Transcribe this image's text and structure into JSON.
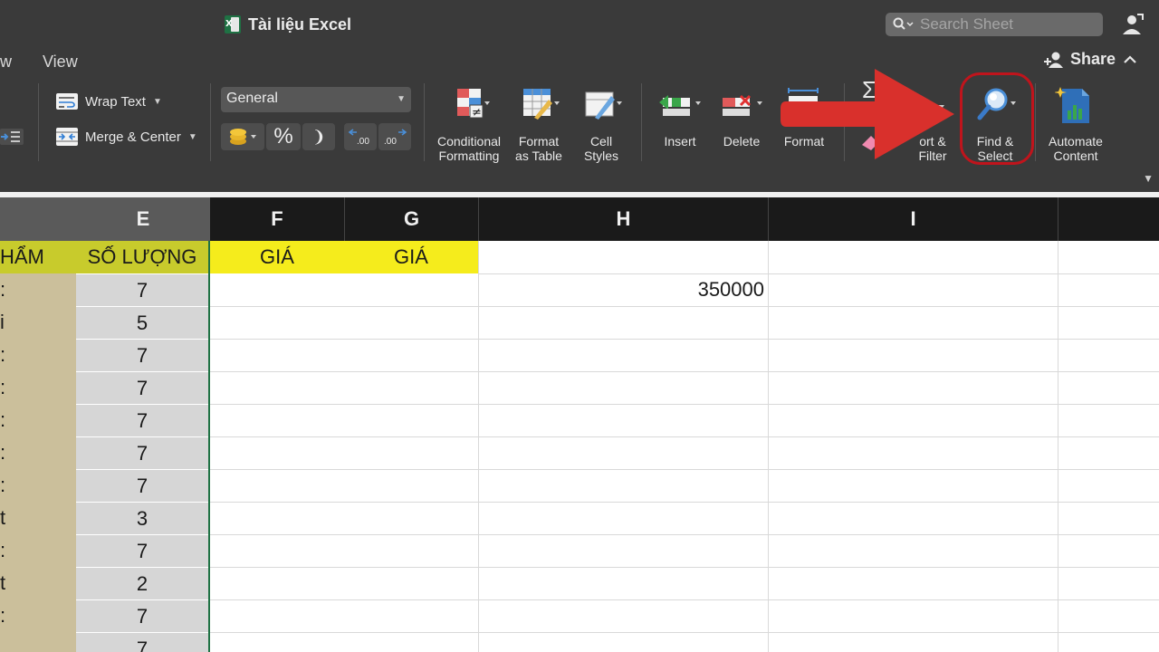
{
  "window": {
    "title": "Tài liệu Excel",
    "search_placeholder": "Search Sheet"
  },
  "menu": {
    "tabs": [
      {
        "label": "w"
      },
      {
        "label": "View"
      }
    ],
    "share_label": "Share",
    "collapse_icon": "chevron-up-icon"
  },
  "ribbon": {
    "wrap_text": "Wrap Text",
    "merge_center": "Merge & Center",
    "number_format": "General",
    "percent": "%",
    "comma": "❩",
    "inc_decimal": ".00",
    "dec_decimal": ".00",
    "conditional_formatting": {
      "line1": "Conditional",
      "line2": "Formatting"
    },
    "format_as_table": {
      "line1": "Format",
      "line2": "as Table"
    },
    "cell_styles": {
      "line1": "Cell",
      "line2": "Styles"
    },
    "insert": "Insert",
    "delete": "Delete",
    "format": "Format",
    "sort_filter": {
      "line1": "ort &",
      "line2": "Filter"
    },
    "find_select": {
      "line1": "Find &",
      "line2": "Select"
    },
    "automate_content": {
      "line1": "Automate",
      "line2": "Content"
    },
    "autosum_symbol": "Σ"
  },
  "annotation": {
    "arrow_color": "#d9302c",
    "highlight_color": "#c0141c"
  },
  "sheet": {
    "columns": [
      "E",
      "F",
      "G",
      "H",
      "I"
    ],
    "header_row": {
      "d_partial": "HẨM",
      "e": "SỐ LƯỢNG",
      "f": "GIÁ",
      "g": "GIÁ"
    },
    "d_partial_values": [
      ":",
      "i",
      ":",
      ":",
      ":",
      ":",
      ":",
      "t",
      ":",
      "t",
      ":",
      ""
    ],
    "e_values": [
      "7",
      "5",
      "7",
      "7",
      "7",
      "7",
      "7",
      "3",
      "7",
      "2",
      "7",
      "7"
    ],
    "h_first": "350000"
  },
  "colors": {
    "header_yellow": "#f5ec1c",
    "header_olive": "#c8cb2c",
    "d_column_fill": "#cbbf9b",
    "e_column_fill": "#d6d6d6",
    "selection_border": "#1f7244"
  }
}
